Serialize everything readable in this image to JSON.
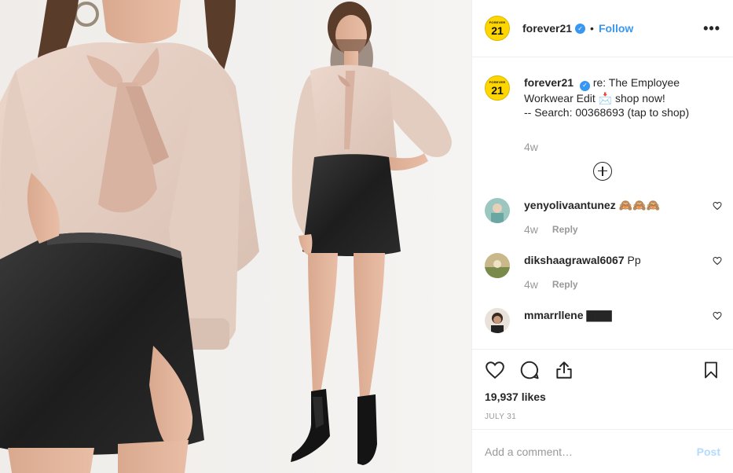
{
  "post": {
    "account": "forever21",
    "follow_label": "Follow",
    "dot": "•",
    "more_label": "•••",
    "logo_small": "FOREVER",
    "logo_big": "21"
  },
  "caption": {
    "username": "forever21",
    "text_part1": "re: The Employee Workwear Edit",
    "emoji": "📩",
    "text_part2": "shop now!",
    "text_line2": "-- Search: 00368693 (tap to shop)",
    "age": "4w"
  },
  "comments": [
    {
      "username": "yenyolivaantunez",
      "text": "🙈🙈🙈",
      "age": "4w",
      "reply_label": "Reply"
    },
    {
      "username": "dikshaagrawal6067",
      "text": "Pp",
      "age": "4w",
      "reply_label": "Reply"
    },
    {
      "username": "mmarrllene",
      "text": "▇▇▇",
      "age": "",
      "reply_label": ""
    }
  ],
  "footer": {
    "likes": "19,937 likes",
    "date": "JULY 31",
    "add_comment_placeholder": "Add a comment…",
    "post_label": "Post"
  },
  "colors": {
    "accent": "#3897f0",
    "logo_yellow": "#ffd600",
    "post_disabled": "#b3dbff"
  },
  "icons": [
    "heart-icon",
    "comment-icon",
    "share-icon",
    "bookmark-icon",
    "add-circle-icon",
    "verified-icon",
    "more-icon"
  ]
}
